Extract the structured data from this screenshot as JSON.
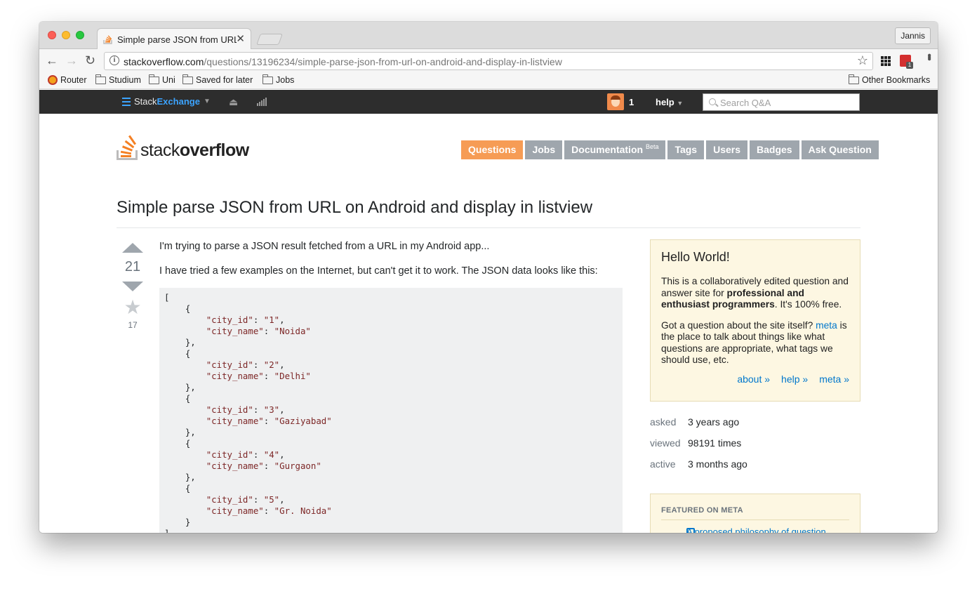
{
  "browser": {
    "tab_title": "Simple parse JSON from URL o",
    "profile_name": "Jannis",
    "url_host": "stackoverflow.com",
    "url_path": "/questions/13196234/simple-parse-json-from-url-on-android-and-display-in-listview",
    "bookmarks": [
      "Router",
      "Studium",
      "Uni",
      "Saved for later",
      "Jobs"
    ],
    "other_bookmarks": "Other Bookmarks",
    "cal_badge": "1"
  },
  "topbar": {
    "logo_stack": "Stack",
    "logo_exchange": "Exchange",
    "reputation": "1",
    "help_label": "help",
    "search_placeholder": "Search Q&A"
  },
  "site": {
    "logo_light": "stack",
    "logo_bold": "overflow",
    "nav": [
      {
        "label": "Questions",
        "active": true
      },
      {
        "label": "Jobs"
      },
      {
        "label": "Documentation",
        "badge": "Beta"
      },
      {
        "label": "Tags"
      },
      {
        "label": "Users"
      },
      {
        "label": "Badges"
      },
      {
        "label": "Ask Question"
      }
    ]
  },
  "question": {
    "title": "Simple parse JSON from URL on Android and display in listview",
    "votes": "21",
    "favorites": "17",
    "paragraph1": "I'm trying to parse a JSON result fetched from a URL in my Android app...",
    "paragraph2": "I have tried a few examples on the Internet, but can't get it to work. The JSON data looks like this:",
    "cities": [
      {
        "id": "1",
        "name": "Noida"
      },
      {
        "id": "2",
        "name": "Delhi"
      },
      {
        "id": "3",
        "name": "Gaziyabad"
      },
      {
        "id": "4",
        "name": "Gurgaon"
      },
      {
        "id": "5",
        "name": "Gr. Noida"
      }
    ]
  },
  "sidebar": {
    "welcome_title": "Hello World!",
    "welcome_text1a": "This is a collaboratively edited question and answer site for ",
    "welcome_text1b": "professional and enthusiast programmers",
    "welcome_text1c": ". It's 100% free.",
    "welcome_text2a": "Got a question about the site itself? ",
    "welcome_text2_link": "meta",
    "welcome_text2b": " is the place to talk about things like what questions are appropriate, what tags we should use, etc.",
    "link_about": "about »",
    "link_help": "help »",
    "link_meta": "meta »",
    "stats": [
      {
        "label": "asked",
        "value": "3 years ago"
      },
      {
        "label": "viewed",
        "value": "98191 times"
      },
      {
        "label": "active",
        "value": "3 months ago"
      }
    ],
    "featured_header": "FEATURED ON META",
    "featured_item": "A proposed philosophy of question"
  },
  "colors": {
    "accent": "#f48024",
    "link": "#0077cc",
    "nav_active": "#f69c55",
    "nav_inactive": "#9fa6ad"
  }
}
